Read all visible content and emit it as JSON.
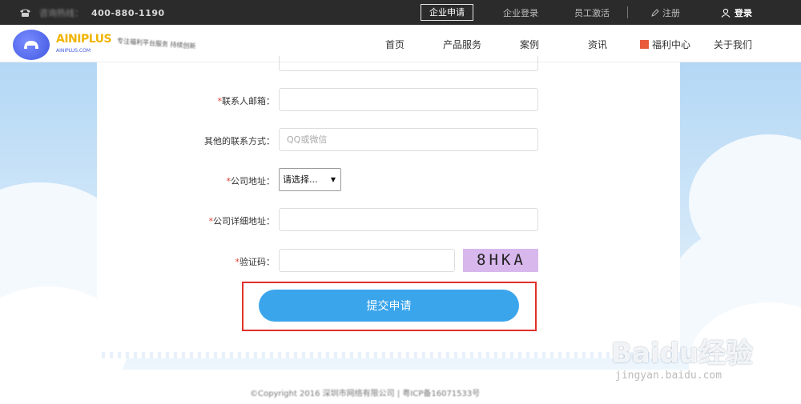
{
  "topbar": {
    "phone_label": "咨询热线：",
    "phone_number": "400-880-1190",
    "items": [
      "企业申请",
      "企业登录",
      "员工激活",
      "注册",
      "登录"
    ]
  },
  "nav": {
    "logo_title": "AINIPLUS",
    "logo_sub": "AINIPLUS.COM",
    "slogan": "专注福利平台服务 持续创新",
    "items": [
      "首页",
      "产品服务",
      "案例",
      "资讯",
      "福利中心",
      "关于我们"
    ]
  },
  "form": {
    "email_label": "联系人邮箱：",
    "other_label": "其他的联系方式：",
    "other_placeholder": "QQ或微信",
    "address_label": "公司地址：",
    "address_select": "请选择...",
    "detail_label": "公司详细地址：",
    "captcha_label": "验证码：",
    "captcha_code": "8HKA",
    "submit_label": "提交申请",
    "required_mark": "*"
  },
  "footer": {
    "copyright": "©Copyright 2016 深圳市网络有限公司 | 粤ICP备16071533号"
  },
  "watermark": {
    "brand": "Baidu经验",
    "url": "jingyan.baidu.com"
  },
  "colors": {
    "accent": "#3ba5ec",
    "highlight": "#e0302a",
    "required": "#e0392d"
  }
}
